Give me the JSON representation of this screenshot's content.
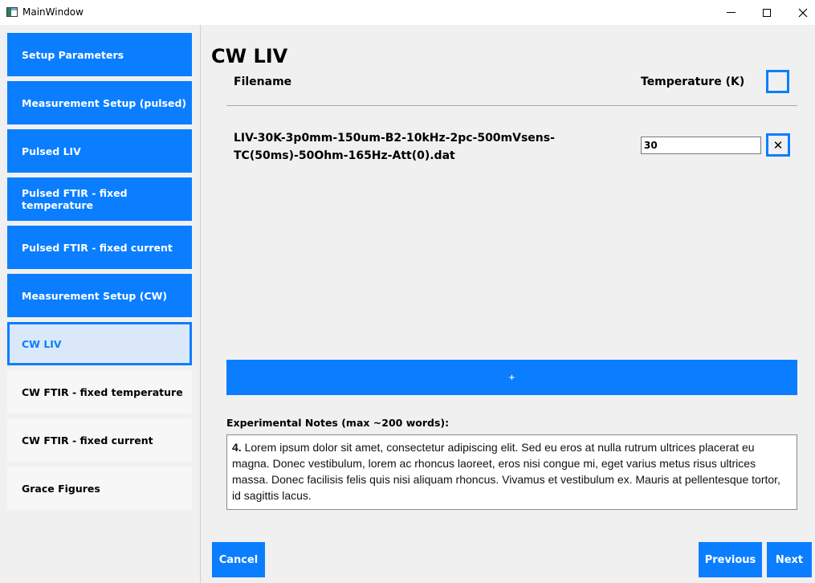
{
  "window": {
    "title": "MainWindow"
  },
  "sidebar": {
    "items": [
      {
        "label": "Setup Parameters"
      },
      {
        "label": "Measurement Setup (pulsed)"
      },
      {
        "label": "Pulsed LIV"
      },
      {
        "label": "Pulsed FTIR - fixed temperature"
      },
      {
        "label": "Pulsed FTIR - fixed current"
      },
      {
        "label": "Measurement Setup (CW)"
      },
      {
        "label": "CW LIV"
      },
      {
        "label": "CW FTIR - fixed temperature"
      },
      {
        "label": "CW FTIR - fixed current"
      },
      {
        "label": "Grace Figures"
      }
    ],
    "active": "CW LIV"
  },
  "main": {
    "title": "CW LIV",
    "columns": {
      "filename": "Filename",
      "temperature": "Temperature (K)"
    },
    "rows": [
      {
        "filename": "LIV-30K-3p0mm-150um-B2-10kHz-2pc-500mVsens-TC(50ms)-50Ohm-165Hz-Att(0).dat",
        "temperature": "30",
        "remove_label": "✕"
      }
    ],
    "add_label": "+",
    "notes": {
      "label": "Experimental Notes (max ~200 words):",
      "number": "4.",
      "text": "Lorem ipsum dolor sit amet, consectetur adipiscing elit. Sed eu eros at nulla rutrum ultrices placerat eu magna. Donec vestibulum, lorem ac rhoncus laoreet, eros nisi congue mi, eget varius metus risus ultrices massa. Donec facilisis felis quis nisi aliquam rhoncus. Vivamus et vestibulum ex. Mauris at pellentesque tortor, id sagittis lacus."
    }
  },
  "footer": {
    "cancel_label": "Cancel",
    "previous_label": "Previous",
    "next_label": "Next"
  },
  "colors": {
    "accent": "#0a7eff",
    "active_bg": "#dbe8fa",
    "inactive_bg": "#f7f7f7",
    "window_bg": "#f0f0f0"
  },
  "icons": {
    "app": "app-window-icon",
    "minimize": "minimize-icon",
    "maximize": "maximize-icon",
    "close": "close-icon",
    "remove": "close-icon"
  }
}
